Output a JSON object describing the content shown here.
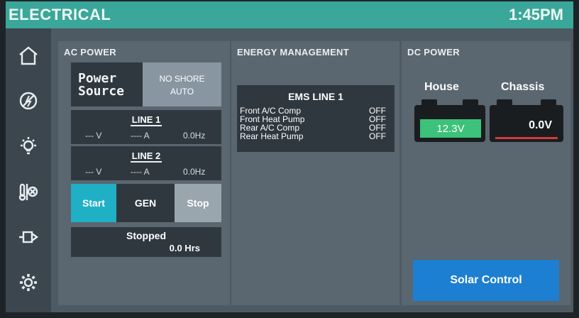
{
  "header": {
    "title": "ELECTRICAL",
    "time": "1:45PM"
  },
  "sidebar": {
    "items": [
      {
        "icon": "home-icon"
      },
      {
        "icon": "power-icon"
      },
      {
        "icon": "light-bulb-icon"
      },
      {
        "icon": "climate-icon"
      },
      {
        "icon": "slide-out-icon"
      },
      {
        "icon": "settings-icon"
      }
    ]
  },
  "ac_power": {
    "title": "AC POWER",
    "power_source_label": "Power Source",
    "shore_line1": "NO SHORE",
    "shore_line2": "AUTO",
    "line1": {
      "title": "LINE 1",
      "volts": "--- V",
      "amps": "---- A",
      "hz": "0.0Hz"
    },
    "line2": {
      "title": "LINE 2",
      "volts": "--- V",
      "amps": "---- A",
      "hz": "0.0Hz"
    },
    "generator": {
      "start_label": "Start",
      "gen_label": "GEN",
      "stop_label": "Stop",
      "status": "Stopped",
      "hours": "0.0 Hrs"
    }
  },
  "energy_management": {
    "title": "ENERGY MANAGEMENT",
    "ems_title": "EMS LINE 1",
    "rows": [
      {
        "label": "Front A/C Comp",
        "state": "OFF"
      },
      {
        "label": "Front Heat Pump",
        "state": "OFF"
      },
      {
        "label": "Rear A/C Comp",
        "state": "OFF"
      },
      {
        "label": "Rear Heat Pump",
        "state": "OFF"
      }
    ]
  },
  "dc_power": {
    "title": "DC POWER",
    "house": {
      "label": "House",
      "value": "12.3V",
      "status_color": "#3cc27a"
    },
    "chassis": {
      "label": "Chassis",
      "value": "0.0V",
      "status_color": "#d63a3a"
    },
    "solar_button": "Solar Control"
  },
  "colors": {
    "accent": "#3aa79a",
    "start": "#1fb0c6",
    "solar": "#1d7fd1"
  }
}
